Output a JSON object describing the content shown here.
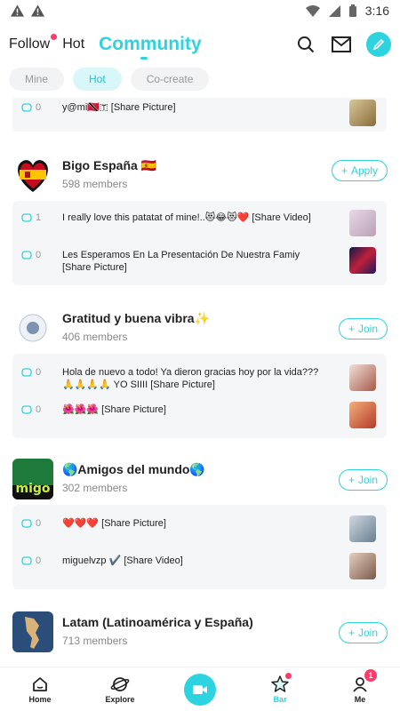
{
  "status": {
    "time": "3:16"
  },
  "nav": {
    "tabs": [
      {
        "label": "Follow",
        "dot": true
      },
      {
        "label": "Hot"
      },
      {
        "label": "Community",
        "active": true
      }
    ]
  },
  "subtabs": [
    {
      "label": "Mine"
    },
    {
      "label": "Hot",
      "active": true
    },
    {
      "label": "Co-create"
    }
  ],
  "partial_post": {
    "count": "0",
    "text": "y@mi🇹🇹🇹 [Share Picture]"
  },
  "groups": [
    {
      "name": "Bigo España 🇪🇸",
      "members": "598 members",
      "button": "Apply",
      "posts": [
        {
          "count": "1",
          "text": "I really love this patatat of mine!..😻😂😻❤️ [Share Video]"
        },
        {
          "count": "0",
          "text": "Les Esperamos En La Presentación De Nuestra Famiy [Share Picture]"
        }
      ]
    },
    {
      "name": "Gratitud y buena vibra✨",
      "members": "406 members",
      "button": "Join",
      "posts": [
        {
          "count": "0",
          "text": "Hola de nuevo a todo! Ya dieron gracias hoy por la vida??? 🙏🙏🙏🙏 YO SIIII  [Share Picture]"
        },
        {
          "count": "0",
          "text": "🌺🌺🌺 [Share Picture]"
        }
      ]
    },
    {
      "name": "🌎Amigos del mundo🌎",
      "members": "302 members",
      "button": "Join",
      "posts": [
        {
          "count": "0",
          "text": "❤️❤️❤️ [Share Picture]"
        },
        {
          "count": "0",
          "text": "miguelvzp ✔️ [Share Video]"
        }
      ]
    },
    {
      "name": "Latam (Latinoamérica y España)",
      "members": "713 members",
      "button": "Join",
      "posts": []
    }
  ],
  "bottom": [
    {
      "label": "Home"
    },
    {
      "label": "Explore"
    },
    {
      "label": ""
    },
    {
      "label": "Bar",
      "active": true
    },
    {
      "label": "Me",
      "badge": "1"
    }
  ],
  "colors": {
    "accent": "#2dd3df",
    "badge": "#ff3b6b"
  }
}
